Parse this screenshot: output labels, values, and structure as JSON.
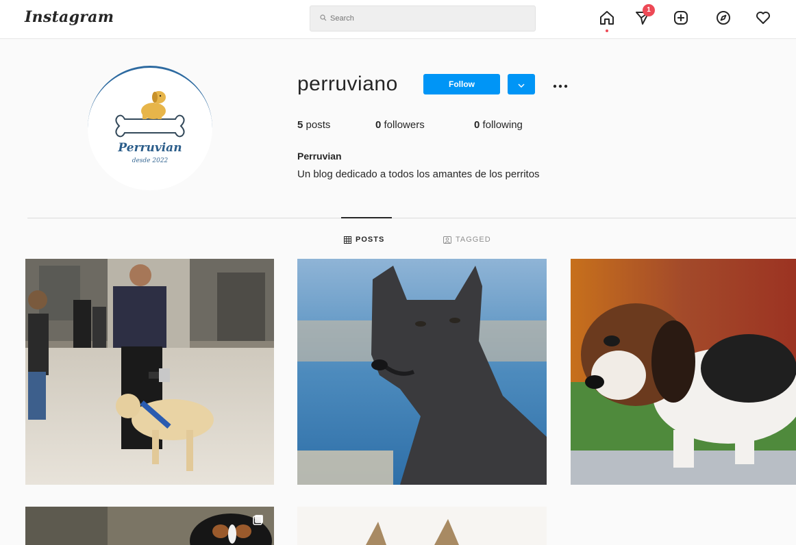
{
  "app": {
    "logo_text": "Instagram"
  },
  "search": {
    "placeholder": "Search",
    "icon": "search-icon"
  },
  "nav": {
    "icons": [
      "home-icon",
      "direct-messages-icon",
      "new-post-icon",
      "explore-icon",
      "activity-heart-icon"
    ],
    "messages_badge": "1"
  },
  "profile": {
    "username": "perruviano",
    "follow_label": "Follow",
    "avatar_text_line1": "Perruvian",
    "avatar_text_line2": "desde 2022",
    "stats": {
      "posts_count": "5",
      "posts_label": "posts",
      "followers_count": "0",
      "followers_label": "followers",
      "following_count": "0",
      "following_label": "following"
    },
    "full_name": "Perruvian",
    "bio": "Un blog dedicado a todos los amantes de los perritos"
  },
  "tabs": [
    {
      "label": "POSTS",
      "icon": "grid-icon",
      "active": true
    },
    {
      "label": "TAGGED",
      "icon": "tagged-icon",
      "active": false
    }
  ],
  "colors": {
    "accent": "#0095f6",
    "notification": "#ed4956",
    "background": "#fafafa"
  }
}
